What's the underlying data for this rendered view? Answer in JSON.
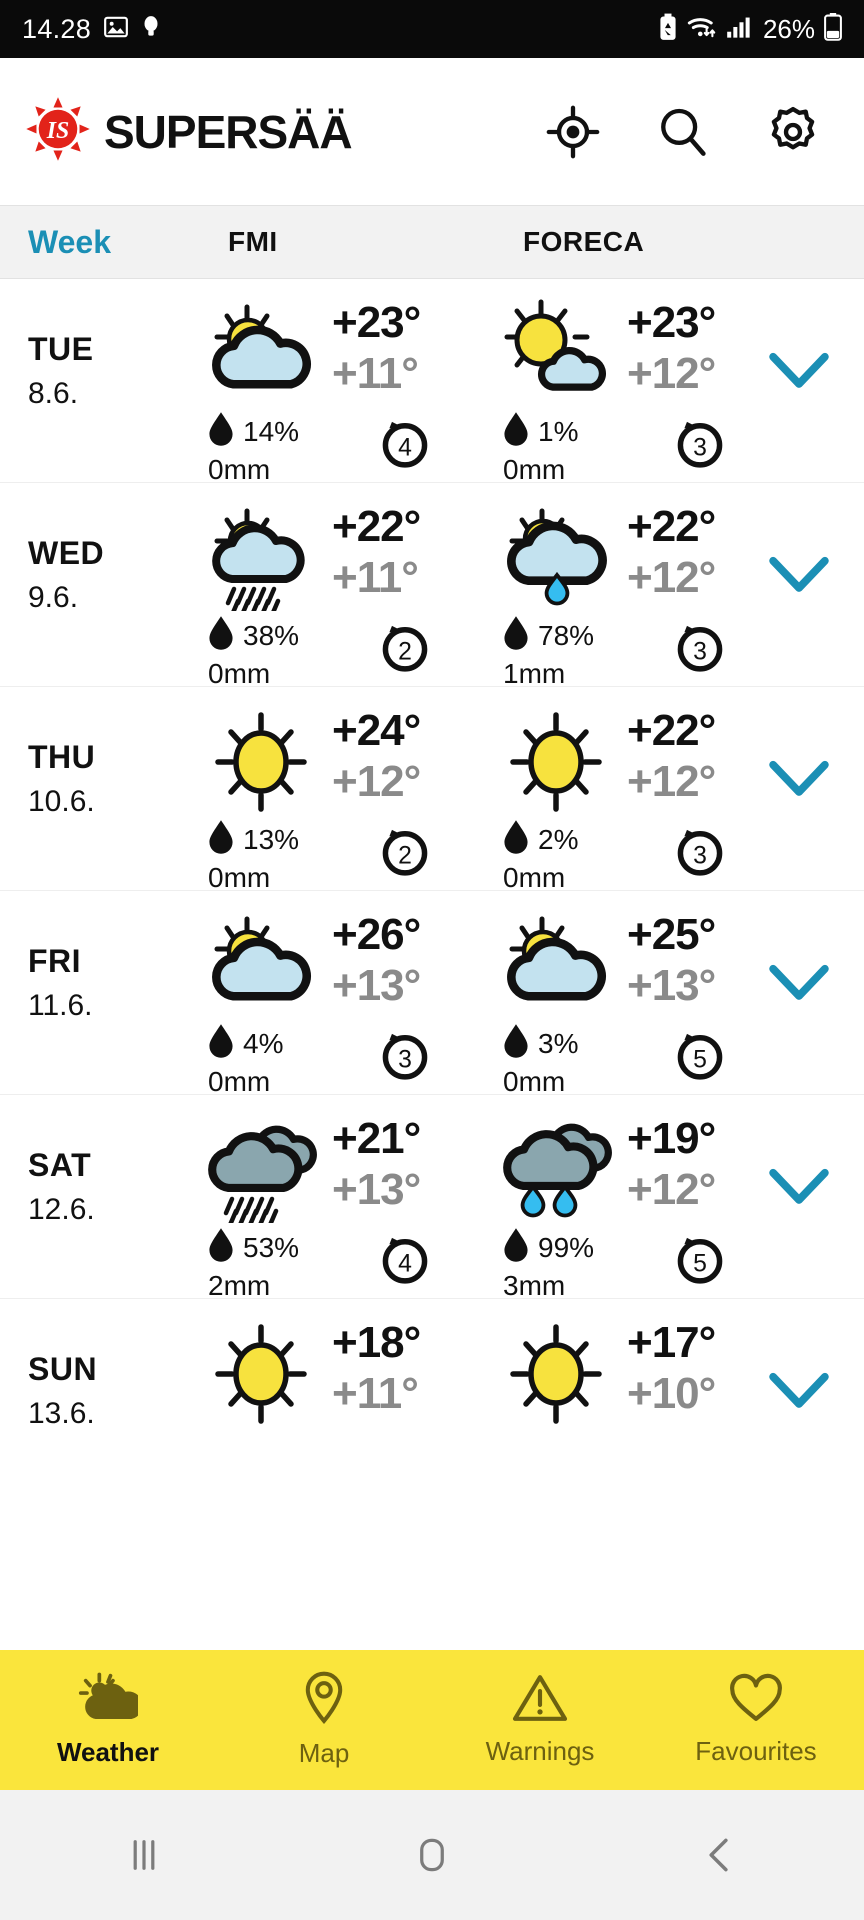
{
  "status_bar": {
    "time": "14.28",
    "battery_percent": "26%",
    "icons": [
      "image-icon",
      "lightbulb-icon",
      "battery-saver-icon",
      "wifi-icon",
      "signal-icon",
      "battery-icon"
    ]
  },
  "app_header": {
    "logo_text": "IS",
    "title": "SUPERSÄÄ",
    "actions": [
      {
        "name": "locate-icon",
        "label": "Locate"
      },
      {
        "name": "search-icon",
        "label": "Search"
      },
      {
        "name": "gear-icon",
        "label": "Settings"
      }
    ]
  },
  "column_header": {
    "week_tab": "Week",
    "provider_1": "FMI",
    "provider_2": "FORECA"
  },
  "forecast": {
    "rows": [
      {
        "day": "TUE",
        "date": "8.6.",
        "fmi": {
          "icon": "sun-behind-cloud",
          "high": "+23°",
          "low": "+11°",
          "precip_pct": "14%",
          "precip_mm": "0mm",
          "wind": "4"
        },
        "foreca": {
          "icon": "sun-with-small-cloud",
          "high": "+23°",
          "low": "+12°",
          "precip_pct": "1%",
          "precip_mm": "0mm",
          "wind": "3"
        }
      },
      {
        "day": "WED",
        "date": "9.6.",
        "fmi": {
          "icon": "sun-cloud-rain-dashes",
          "high": "+22°",
          "low": "+11°",
          "precip_pct": "38%",
          "precip_mm": "0mm",
          "wind": "2"
        },
        "foreca": {
          "icon": "sun-cloud-one-drop",
          "high": "+22°",
          "low": "+12°",
          "precip_pct": "78%",
          "precip_mm": "1mm",
          "wind": "3"
        }
      },
      {
        "day": "THU",
        "date": "10.6.",
        "fmi": {
          "icon": "sun",
          "high": "+24°",
          "low": "+12°",
          "precip_pct": "13%",
          "precip_mm": "0mm",
          "wind": "2"
        },
        "foreca": {
          "icon": "sun",
          "high": "+22°",
          "low": "+12°",
          "precip_pct": "2%",
          "precip_mm": "0mm",
          "wind": "3"
        }
      },
      {
        "day": "FRI",
        "date": "11.6.",
        "fmi": {
          "icon": "sun-behind-cloud",
          "high": "+26°",
          "low": "+13°",
          "precip_pct": "4%",
          "precip_mm": "0mm",
          "wind": "3"
        },
        "foreca": {
          "icon": "sun-behind-cloud",
          "high": "+25°",
          "low": "+13°",
          "precip_pct": "3%",
          "precip_mm": "0mm",
          "wind": "5"
        }
      },
      {
        "day": "SAT",
        "date": "12.6.",
        "fmi": {
          "icon": "gray-clouds-rain-dashes",
          "high": "+21°",
          "low": "+13°",
          "precip_pct": "53%",
          "precip_mm": "2mm",
          "wind": "4"
        },
        "foreca": {
          "icon": "gray-clouds-two-drops",
          "high": "+19°",
          "low": "+12°",
          "precip_pct": "99%",
          "precip_mm": "3mm",
          "wind": "5"
        }
      },
      {
        "day": "SUN",
        "date": "13.6.",
        "fmi": {
          "icon": "sun",
          "high": "+18°",
          "low": "+11°",
          "precip_pct": "",
          "precip_mm": "",
          "wind": ""
        },
        "foreca": {
          "icon": "sun",
          "high": "+17°",
          "low": "+10°",
          "precip_pct": "",
          "precip_mm": "",
          "wind": ""
        }
      }
    ]
  },
  "bottom_nav": {
    "items": [
      {
        "label": "Weather",
        "icon": "sun-cloud-icon",
        "active": true
      },
      {
        "label": "Map",
        "icon": "map-pin-icon",
        "active": false
      },
      {
        "label": "Warnings",
        "icon": "warning-triangle-icon",
        "active": false
      },
      {
        "label": "Favourites",
        "icon": "heart-icon",
        "active": false
      }
    ]
  },
  "android_nav": {
    "recents": "recents-icon",
    "home": "home-icon",
    "back": "back-icon"
  },
  "colors": {
    "accent_teal": "#1b8fb5",
    "brand_red": "#e2231a",
    "nav_yellow": "#fae53c",
    "sun_yellow": "#f7e23e",
    "cloud_blue": "#c3e2ef",
    "cloud_gray": "#8aa6ae",
    "drop_blue": "#35bdf0",
    "low_temp_gray": "#8a8a8a"
  }
}
